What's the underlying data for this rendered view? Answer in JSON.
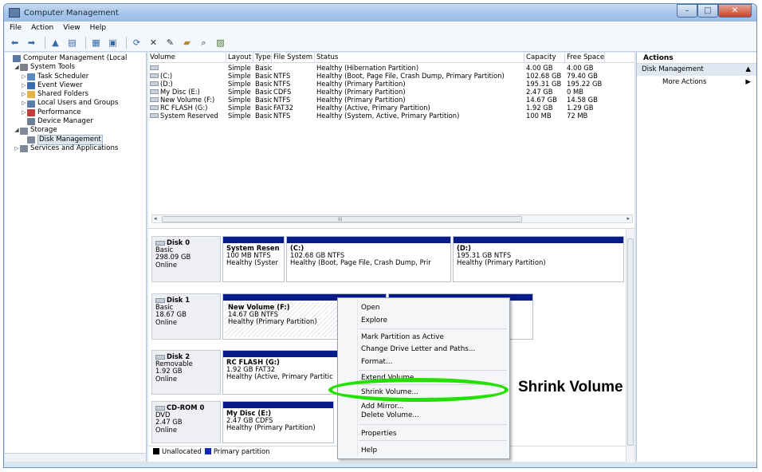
{
  "window": {
    "title": "Computer Management",
    "buttons": [
      "–",
      "□",
      "✕"
    ]
  },
  "menu": [
    "File",
    "Action",
    "View",
    "Help"
  ],
  "toolbar_icons": [
    "back-icon",
    "forward-icon",
    "up-icon",
    "show-hide-tree-icon",
    "properties-icon",
    "help-icon",
    "refresh-icon",
    "delete-icon",
    "settings-icon",
    "folder-icon",
    "search-icon",
    "disk-icon"
  ],
  "tree": [
    {
      "label": "Computer Management (Local",
      "indent": 0,
      "arrow": "",
      "icon": "computer-icon",
      "color": "#5b7aa4"
    },
    {
      "label": "System Tools",
      "indent": 1,
      "arrow": "◢",
      "icon": "tools-icon",
      "color": "#7b7f87"
    },
    {
      "label": "Task Scheduler",
      "indent": 2,
      "arrow": "▷",
      "icon": "clock-icon",
      "color": "#5a8ac2"
    },
    {
      "label": "Event Viewer",
      "indent": 2,
      "arrow": "▷",
      "icon": "event-viewer-icon",
      "color": "#3d6fb0"
    },
    {
      "label": "Shared Folders",
      "indent": 2,
      "arrow": "▷",
      "icon": "shared-folder-icon",
      "color": "#e2b347"
    },
    {
      "label": "Local Users and Groups",
      "indent": 2,
      "arrow": "▷",
      "icon": "users-icon",
      "color": "#5c7ea9"
    },
    {
      "label": "Performance",
      "indent": 2,
      "arrow": "▷",
      "icon": "performance-icon",
      "color": "#c43b3b"
    },
    {
      "label": "Device Manager",
      "indent": 2,
      "arrow": "",
      "icon": "device-manager-icon",
      "color": "#6d7f93"
    },
    {
      "label": "Storage",
      "indent": 1,
      "arrow": "◢",
      "icon": "storage-icon",
      "color": "#7e8a9a"
    },
    {
      "label": "Disk Management",
      "indent": 2,
      "arrow": "",
      "icon": "disk-management-icon",
      "color": "#7e8a9a",
      "selected": true
    },
    {
      "label": "Services and Applications",
      "indent": 1,
      "arrow": "▷",
      "icon": "services-icon",
      "color": "#7e8a9a"
    }
  ],
  "volume_table": {
    "headers": [
      "Volume",
      "Layout",
      "Type",
      "File System",
      "Status",
      "Capacity",
      "Free Space"
    ],
    "rows": [
      [
        "",
        "Simple",
        "Basic",
        "",
        "Healthy (Hibernation Partition)",
        "4.00 GB",
        "4.00 GB"
      ],
      [
        "(C:)",
        "Simple",
        "Basic",
        "NTFS",
        "Healthy (Boot, Page File, Crash Dump, Primary Partition)",
        "102.68 GB",
        "79.40 GB"
      ],
      [
        "(D:)",
        "Simple",
        "Basic",
        "NTFS",
        "Healthy (Primary Partition)",
        "195.31 GB",
        "195.22 GB"
      ],
      [
        "My Disc (E:)",
        "Simple",
        "Basic",
        "CDFS",
        "Healthy (Primary Partition)",
        "2.47 GB",
        "0 MB"
      ],
      [
        "New Volume (F:)",
        "Simple",
        "Basic",
        "NTFS",
        "Healthy (Primary Partition)",
        "14.67 GB",
        "14.58 GB"
      ],
      [
        "RC FLASH (G:)",
        "Simple",
        "Basic",
        "FAT32",
        "Healthy (Active, Primary Partition)",
        "1.92 GB",
        "1.29 GB"
      ],
      [
        "System Reserved",
        "Simple",
        "Basic",
        "NTFS",
        "Healthy (System, Active, Primary Partition)",
        "100 MB",
        "72 MB"
      ]
    ]
  },
  "hscroll_grip": "III",
  "disks": [
    {
      "name": "Disk 0",
      "lines": [
        "Basic",
        "298.09 GB",
        "Online"
      ],
      "partitions": [
        {
          "title": "System Resen",
          "lines": [
            "100 MB NTFS",
            "Healthy (Syster"
          ]
        },
        {
          "title": "(C:)",
          "lines": [
            "102.68 GB NTFS",
            "Healthy (Boot, Page File, Crash Dump, Prir"
          ]
        },
        {
          "title": "(D:)",
          "lines": [
            "195.31 GB NTFS",
            "Healthy (Primary Partition)"
          ]
        }
      ]
    },
    {
      "name": "Disk 1",
      "lines": [
        "Basic",
        "18.67 GB",
        "Online"
      ],
      "partitions": [
        {
          "title": "New Volume (F:)",
          "lines": [
            "14.67 GB NTFS",
            "Healthy (Primary Partition)"
          ]
        },
        {
          "title": "",
          "lines": []
        }
      ]
    },
    {
      "name": "Disk 2",
      "lines": [
        "Removable",
        "1.92 GB",
        "Online"
      ],
      "partitions": [
        {
          "title": "RC FLASH (G:)",
          "lines": [
            "1.92 GB FAT32",
            "Healthy (Active, Primary Partitic"
          ]
        }
      ]
    },
    {
      "name": "CD-ROM 0",
      "lines": [
        "DVD",
        "2.47 GB",
        "Online"
      ],
      "partitions": [
        {
          "title": "My Disc (E:)",
          "lines": [
            "2.47 GB CDFS",
            "Healthy (Primary Partition)"
          ]
        }
      ]
    }
  ],
  "legend": [
    {
      "label": "Unallocated",
      "color": "#000000"
    },
    {
      "label": "Primary partition",
      "color": "#0f2bb5"
    }
  ],
  "actions": {
    "header": "Actions",
    "section": "Disk Management",
    "more": "More Actions"
  },
  "context_menu": {
    "items": [
      "Open",
      "Explore",
      "Mark Partition as Active",
      "Change Drive Letter and Paths...",
      "Format...",
      "Extend Volume...",
      "Shrink Volume...",
      "Add Mirror...",
      "Delete Volume...",
      "Properties",
      "Help"
    ]
  },
  "callout": {
    "label": "Shrink Volume",
    "color": "#22e000"
  }
}
